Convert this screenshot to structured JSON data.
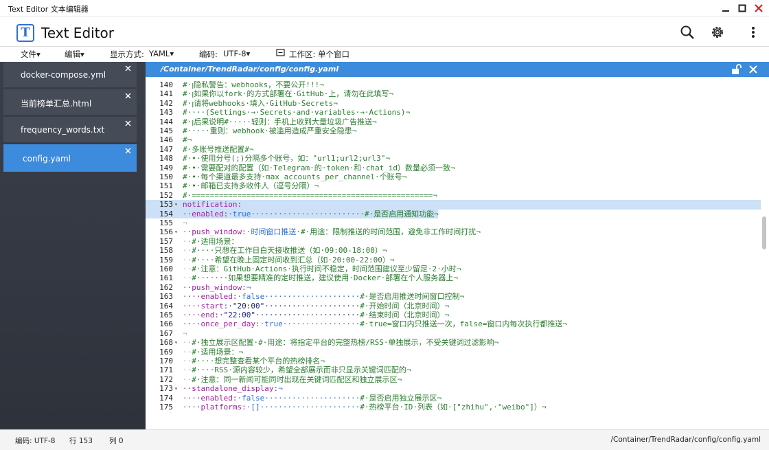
{
  "window": {
    "title": "Text Editor 文本编辑器"
  },
  "app": {
    "logo_letter": "T",
    "title": "Text Editor"
  },
  "header_icons": [
    "search-icon",
    "gear-icon",
    "more-vertical-icon"
  ],
  "menu": {
    "file": "文件▾",
    "edit": "编辑▾",
    "display_mode_label": "显示方式:",
    "display_mode_value": "YAML▾",
    "encoding_label": "编码:",
    "encoding_value": "UTF-8▾",
    "workspace": "工作区: 单个窗口"
  },
  "tabs": [
    {
      "label": "docker-compose.yml",
      "active": false
    },
    {
      "label": "当前榜单汇总.html",
      "active": false
    },
    {
      "label": "frequency_words.txt",
      "active": false
    },
    {
      "label": "config.yaml",
      "active": true
    }
  ],
  "editor": {
    "path": "/Container/TrendRadar/config/config.yaml",
    "lines": [
      {
        "n": "140",
        "t": "#·ꞁ隐私警告：webhooks，不要公开!!!¬"
      },
      {
        "n": "141",
        "t": "#·ꞁ如果你以fork·的方式部署在·GitHub·上，请勿在此填写¬"
      },
      {
        "n": "142",
        "t": "#·ꞁ请将webhooks·填入·GitHub·Secrets¬"
      },
      {
        "n": "143",
        "t": "#····(Settings·→·Secrets·and·variables·→·Actions)¬"
      },
      {
        "n": "144",
        "t": "#·ꞁ后果说明#·····轻则：手机上收到大量垃圾广告推送¬"
      },
      {
        "n": "145",
        "t": "#·····重则：webhook·被滥用造成严重安全隐患¬"
      },
      {
        "n": "146",
        "t": "#¬"
      },
      {
        "n": "147",
        "t": "#·多账号推送配置#¬"
      },
      {
        "n": "148",
        "t": "#·•·使用分号(;)分隔多个账号，如：\"url1;url2;url3\"¬"
      },
      {
        "n": "149",
        "t": "#·•·需要配对的配置（如·Telegram·的·token·和·chat_id）数量必须一致¬"
      },
      {
        "n": "150",
        "t": "#·•·每个渠道最多支持·max_accounts_per_channel·个账号¬"
      },
      {
        "n": "151",
        "t": "#·•·邮箱已支持多收件人（逗号分隔）¬"
      },
      {
        "n": "152",
        "t": "#·=====================================================¬"
      },
      {
        "n": "153",
        "t": "notification:",
        "fold": "▾",
        "hl": true
      },
      {
        "n": "154",
        "t": "··enabled:·true·························#·是否启用通知功能¬",
        "hl2": true
      },
      {
        "n": "155",
        "t": "¬"
      },
      {
        "n": "156",
        "t": "··push_window:·时间窗口推送·#·用途：限制推送的时间范围，避免非工作时间打扰¬",
        "fold": "▾"
      },
      {
        "n": "157",
        "t": "··#·适用场景："
      },
      {
        "n": "158",
        "t": "··#····只想在工作日白天接收推送（如·09:00-18:00）¬"
      },
      {
        "n": "159",
        "t": "··#····希望在晚上固定时间收到汇总（如·20:00-22:00）¬"
      },
      {
        "n": "160",
        "t": "··#·注意：GitHub·Actions·执行时间不稳定，时间范围建议至少留足·2·小时¬"
      },
      {
        "n": "161",
        "t": "··#·······如果想要精准的定时推送，建议使用·Docker·部署在个人服务器上¬"
      },
      {
        "n": "162",
        "t": "··push_window:¬"
      },
      {
        "n": "163",
        "t": "····enabled:·false·····················#·是否启用推送时间窗口控制¬"
      },
      {
        "n": "164",
        "t": "····start:·\"20:00\"·····················#·开始时间（北京时间）¬"
      },
      {
        "n": "165",
        "t": "····end:·\"22:00\"·······················#·结束时间（北京时间）¬"
      },
      {
        "n": "166",
        "t": "····once_per_day:·true·················#·true=窗口内只推送一次，false=窗口内每次执行都推送¬"
      },
      {
        "n": "167",
        "t": "¬"
      },
      {
        "n": "168",
        "t": "··#·独立展示区配置·#·用途：将指定平台的完整热榜/RSS·单独展示，不受关键词过滤影响¬",
        "fold": "▾"
      },
      {
        "n": "169",
        "t": "··#·适用场景：¬"
      },
      {
        "n": "170",
        "t": "··#····想完整查看某个平台的热榜排名¬"
      },
      {
        "n": "171",
        "t": "··#····RSS·源内容较少，希望全部展示而非只显示关键词匹配的¬"
      },
      {
        "n": "172",
        "t": "··#·注意：同一新闻可能同时出现在关键词匹配区和独立展示区¬"
      },
      {
        "n": "173",
        "t": "··standalone_display:¬",
        "fold": "▾"
      },
      {
        "n": "174",
        "t": "····enabled:·false·····················#·是否启用独立展示区¬"
      },
      {
        "n": "175",
        "t": "····platforms:·[]······················#·热榜平台·ID·列表（如·[\"zhihu\",·\"weibo\"]）¬"
      }
    ]
  },
  "status": {
    "encoding": "编码: UTF-8",
    "row": "行 153",
    "col": "列 0",
    "path": "/Container/TrendRadar/config/config.yaml"
  },
  "colors": {
    "accent": "#3d8bdc",
    "sidebar": "#3a3f4a",
    "comment": "#2e7d32"
  }
}
